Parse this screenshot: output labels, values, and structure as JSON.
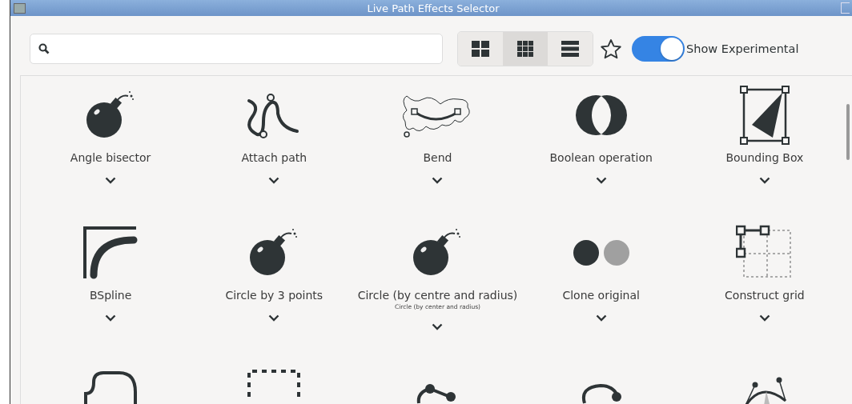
{
  "window": {
    "title": "Live Path Effects Selector"
  },
  "view_modes": [
    {
      "kind": "large",
      "selected": false
    },
    {
      "kind": "small",
      "selected": true
    },
    {
      "kind": "list",
      "selected": false
    }
  ],
  "experimental": {
    "label": "Show Experimental",
    "on": true
  },
  "effects": [
    {
      "label": "Angle bisector"
    },
    {
      "label": "Attach path"
    },
    {
      "label": "Bend"
    },
    {
      "label": "Boolean operation"
    },
    {
      "label": "Bounding Box"
    },
    {
      "label": "BSpline"
    },
    {
      "label": "Circle by 3 points"
    },
    {
      "label": "Circle (by centre and radius)",
      "subtitle": "Circle (by center and radius)"
    },
    {
      "label": "Clone original"
    },
    {
      "label": "Construct grid"
    }
  ]
}
